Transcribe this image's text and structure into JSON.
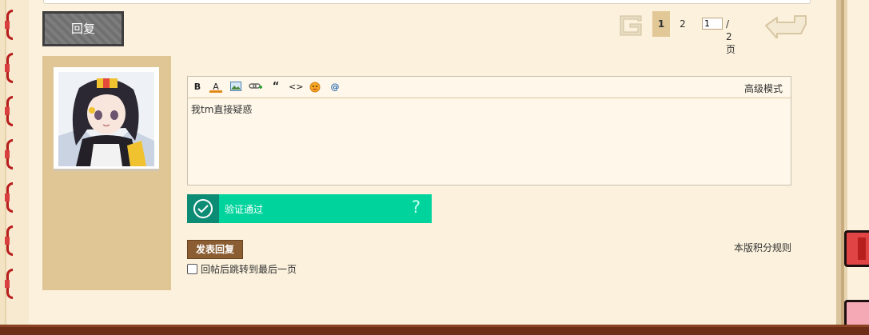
{
  "actions": {
    "reply_label": "回复"
  },
  "pagination": {
    "pages": [
      "1",
      "2"
    ],
    "current": "1",
    "input_value": "1",
    "total_label": "/ 2 页"
  },
  "editor": {
    "toolbar": [
      {
        "icon": "bold-icon",
        "glyph": "B"
      },
      {
        "icon": "font-color-icon",
        "glyph": "A"
      },
      {
        "icon": "image-icon",
        "glyph": ""
      },
      {
        "icon": "link-icon",
        "glyph": ""
      },
      {
        "icon": "quote-icon",
        "glyph": "“"
      },
      {
        "icon": "code-icon",
        "glyph": "<>"
      },
      {
        "icon": "emoji-icon",
        "glyph": ""
      },
      {
        "icon": "at-icon",
        "glyph": "@"
      }
    ],
    "advanced_mode_label": "高级模式",
    "content": "我tm直接疑惑"
  },
  "verification": {
    "status_label": "验证通过",
    "help_label": "?"
  },
  "submit": {
    "label": "发表回复"
  },
  "rules_link": "本版积分规则",
  "jump_checkbox": {
    "label": "回帖后跳转到最后一页",
    "checked": false
  },
  "colors": {
    "paper": "#fbf1dc",
    "author_panel": "#e0c595",
    "verify_green": "#00d49c",
    "submit_brown": "#8b5d33",
    "binding_red": "#b81d1d"
  }
}
